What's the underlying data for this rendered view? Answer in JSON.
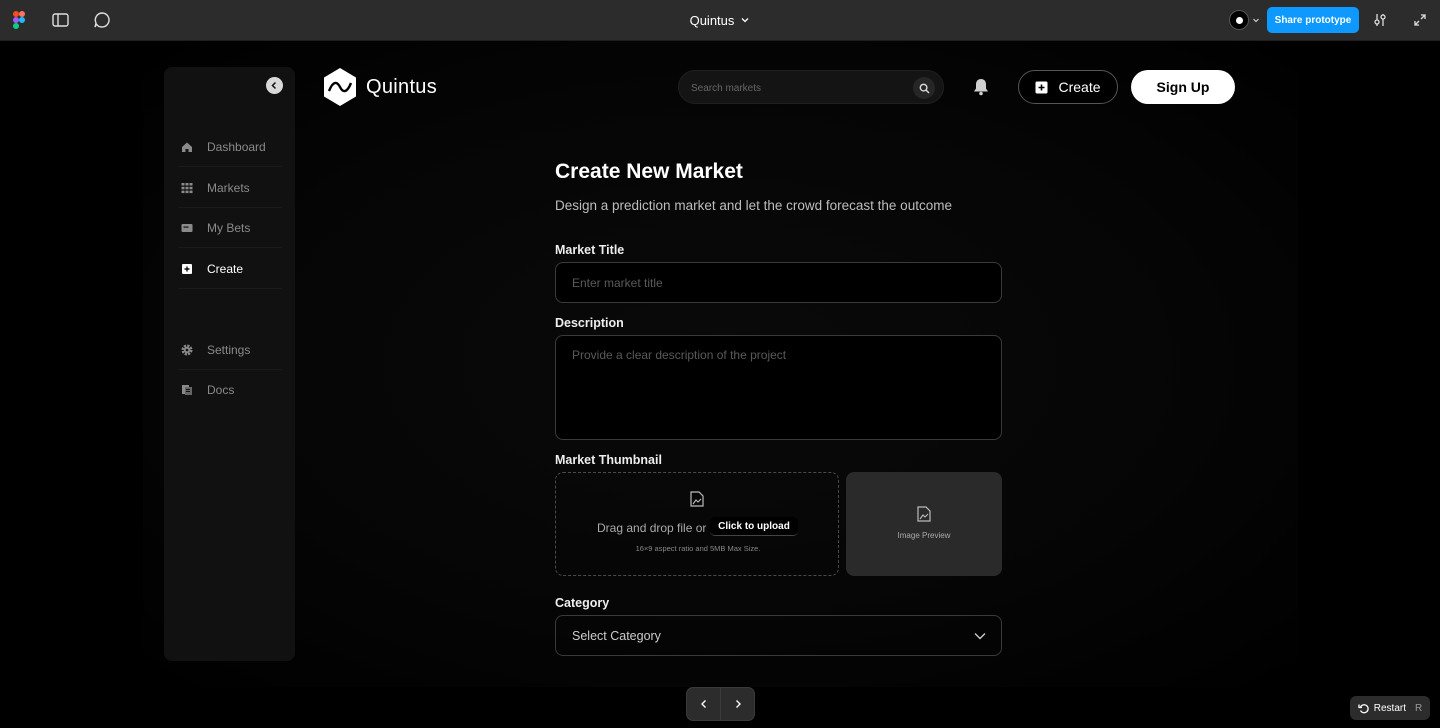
{
  "figma": {
    "file_title": "Quintus",
    "share_label": "Share prototype",
    "restart_label": "Restart",
    "restart_key": "R"
  },
  "app": {
    "brand": "Quintus",
    "search_placeholder": "Search markets",
    "create_label": "Create",
    "signup_label": "Sign Up"
  },
  "sidebar": {
    "items": [
      {
        "label": "Dashboard",
        "icon": "home-icon"
      },
      {
        "label": "Markets",
        "icon": "grid-icon"
      },
      {
        "label": "My Bets",
        "icon": "ticket-icon"
      },
      {
        "label": "Create",
        "icon": "plus-square-icon",
        "active": true
      },
      {
        "label": "Settings",
        "icon": "gear-icon"
      },
      {
        "label": "Docs",
        "icon": "docs-icon"
      }
    ]
  },
  "form": {
    "title": "Create New Market",
    "subtitle": "Design a prediction market and let the crowd forecast the outcome",
    "market_title_label": "Market Title",
    "market_title_placeholder": "Enter market title",
    "description_label": "Description",
    "description_placeholder": "Provide a clear description of the project",
    "thumbnail_label": "Market Thumbnail",
    "dropzone_text": "Drag and drop file or",
    "upload_label": "Click to upload",
    "dropzone_note": "16×9 aspect ratio and 5MB Max Size.",
    "preview_label": "Image Preview",
    "category_label": "Category",
    "category_value": "Select Category"
  },
  "colors": {
    "figma_blue": "#0d99ff",
    "background": "#000000",
    "sidebar_bg": "#111111"
  }
}
